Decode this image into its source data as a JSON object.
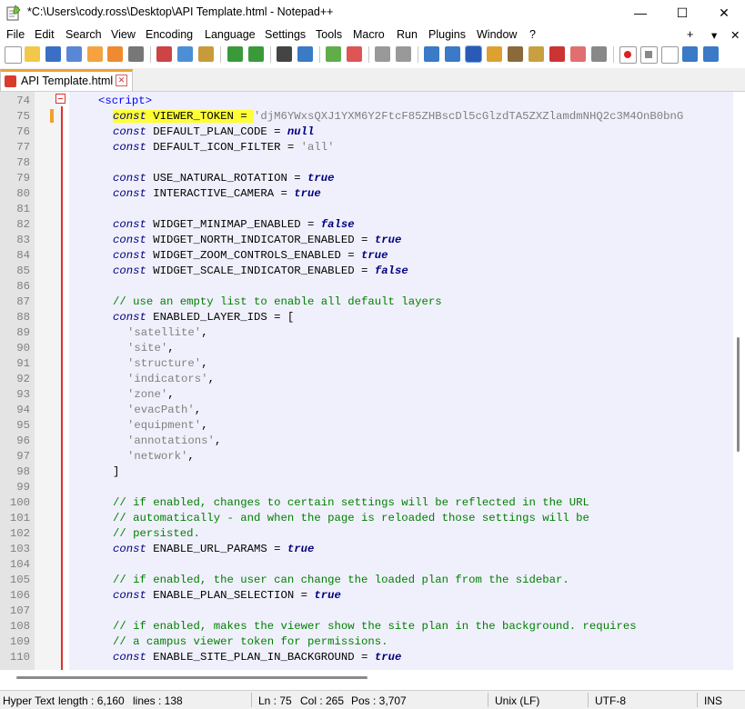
{
  "window": {
    "title": "*C:\\Users\\cody.ross\\Desktop\\API Template.html - Notepad++",
    "minimize": "—",
    "maximize": "☐",
    "close": "✕"
  },
  "menu": [
    "File",
    "Edit",
    "Search",
    "View",
    "Encoding",
    "Language",
    "Settings",
    "Tools",
    "Macro",
    "Run",
    "Plugins",
    "Window",
    "?"
  ],
  "menu_right": {
    "plus": "+",
    "down": "▾",
    "close": "✕"
  },
  "tab": {
    "label": "API Template.html",
    "close": "✕"
  },
  "code_lines": [
    {
      "n": "74",
      "html": "<span class=\"tag\">&lt;script&gt;</span>",
      "indent": 0
    },
    {
      "n": "75",
      "html": "<span class=\"hl\"><span class=\"kw\">const</span> VIEWER_TOKEN = </span><span class=\"str\">'djM6YWxsQXJ1YXM6Y2FtcF85ZHBscDl5cGlzdTA5ZXZlamdmNHQ2c3M4OnB0bnG</span>",
      "indent": 1,
      "current": true
    },
    {
      "n": "76",
      "html": "<span class=\"kw\">const</span> DEFAULT_PLAN_CODE = <span class=\"lit\">null</span>",
      "indent": 1
    },
    {
      "n": "77",
      "html": "<span class=\"kw\">const</span> DEFAULT_ICON_FILTER = <span class=\"str\">'all'</span>",
      "indent": 1
    },
    {
      "n": "78",
      "html": "",
      "indent": 1
    },
    {
      "n": "79",
      "html": "<span class=\"kw\">const</span> USE_NATURAL_ROTATION = <span class=\"lit\">true</span>",
      "indent": 1
    },
    {
      "n": "80",
      "html": "<span class=\"kw\">const</span> INTERACTIVE_CAMERA = <span class=\"lit\">true</span>",
      "indent": 1
    },
    {
      "n": "81",
      "html": "",
      "indent": 1
    },
    {
      "n": "82",
      "html": "<span class=\"kw\">const</span> WIDGET_MINIMAP_ENABLED = <span class=\"lit\">false</span>",
      "indent": 1
    },
    {
      "n": "83",
      "html": "<span class=\"kw\">const</span> WIDGET_NORTH_INDICATOR_ENABLED = <span class=\"lit\">true</span>",
      "indent": 1
    },
    {
      "n": "84",
      "html": "<span class=\"kw\">const</span> WIDGET_ZOOM_CONTROLS_ENABLED = <span class=\"lit\">true</span>",
      "indent": 1
    },
    {
      "n": "85",
      "html": "<span class=\"kw\">const</span> WIDGET_SCALE_INDICATOR_ENABLED = <span class=\"lit\">false</span>",
      "indent": 1
    },
    {
      "n": "86",
      "html": "",
      "indent": 1
    },
    {
      "n": "87",
      "html": "<span class=\"cmt\">// use an empty list to enable all default layers</span>",
      "indent": 1
    },
    {
      "n": "88",
      "html": "<span class=\"kw\">const</span> ENABLED_LAYER_IDS = [",
      "indent": 1
    },
    {
      "n": "89",
      "html": "<span class=\"str\">'satellite'</span>,",
      "indent": 2
    },
    {
      "n": "90",
      "html": "<span class=\"str\">'site'</span>,",
      "indent": 2
    },
    {
      "n": "91",
      "html": "<span class=\"str\">'structure'</span>,",
      "indent": 2
    },
    {
      "n": "92",
      "html": "<span class=\"str\">'indicators'</span>,",
      "indent": 2
    },
    {
      "n": "93",
      "html": "<span class=\"str\">'zone'</span>,",
      "indent": 2
    },
    {
      "n": "94",
      "html": "<span class=\"str\">'evacPath'</span>,",
      "indent": 2
    },
    {
      "n": "95",
      "html": "<span class=\"str\">'equipment'</span>,",
      "indent": 2
    },
    {
      "n": "96",
      "html": "<span class=\"str\">'annotations'</span>,",
      "indent": 2
    },
    {
      "n": "97",
      "html": "<span class=\"str\">'network'</span>,",
      "indent": 2
    },
    {
      "n": "98",
      "html": "]",
      "indent": 1
    },
    {
      "n": "99",
      "html": "",
      "indent": 1
    },
    {
      "n": "100",
      "html": "<span class=\"cmt\">// if enabled, changes to certain settings will be reflected in the URL</span>",
      "indent": 1
    },
    {
      "n": "101",
      "html": "<span class=\"cmt\">// automatically - and when the page is reloaded those settings will be</span>",
      "indent": 1
    },
    {
      "n": "102",
      "html": "<span class=\"cmt\">// persisted.</span>",
      "indent": 1
    },
    {
      "n": "103",
      "html": "<span class=\"kw\">const</span> ENABLE_URL_PARAMS = <span class=\"lit\">true</span>",
      "indent": 1
    },
    {
      "n": "104",
      "html": "",
      "indent": 1
    },
    {
      "n": "105",
      "html": "<span class=\"cmt\">// if enabled, the user can change the loaded plan from the sidebar.</span>",
      "indent": 1
    },
    {
      "n": "106",
      "html": "<span class=\"kw\">const</span> ENABLE_PLAN_SELECTION = <span class=\"lit\">true</span>",
      "indent": 1
    },
    {
      "n": "107",
      "html": "",
      "indent": 1
    },
    {
      "n": "108",
      "html": "<span class=\"cmt\">// if enabled, makes the viewer show the site plan in the background. requires</span>",
      "indent": 1
    },
    {
      "n": "109",
      "html": "<span class=\"cmt\">// a campus viewer token for permissions.</span>",
      "indent": 1
    },
    {
      "n": "110",
      "html": "<span class=\"kw\">const</span> ENABLE_SITE_PLAN_IN_BACKGROUND = <span class=\"lit\">true</span>",
      "indent": 1
    }
  ],
  "status": {
    "file_type": "Hyper Text",
    "length": "length : 6,160",
    "lines": "lines : 138",
    "ln": "Ln : 75",
    "col": "Col : 265",
    "pos": "Pos : 3,707",
    "eol": "Unix (LF)",
    "encoding": "UTF-8",
    "mode": "INS"
  },
  "colors": {
    "keyword": "#000080",
    "string": "#808080",
    "comment": "#008000",
    "highlight": "#ffff33",
    "fold": "#e03030"
  }
}
